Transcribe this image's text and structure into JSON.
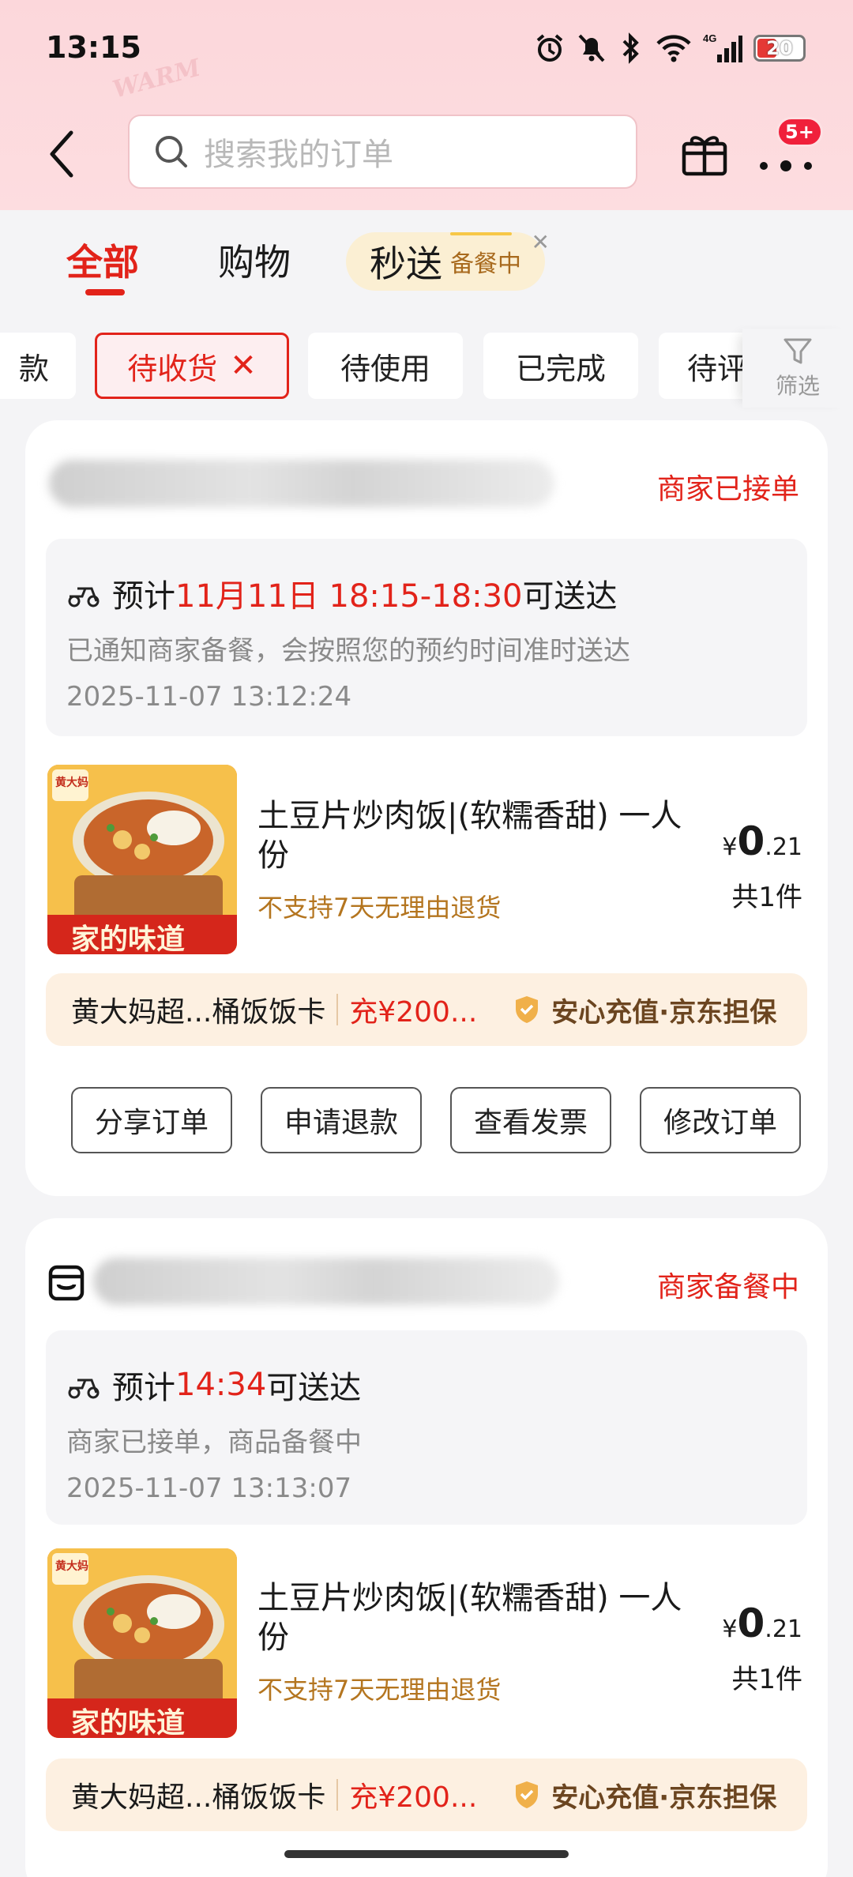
{
  "status_bar": {
    "time": "13:15",
    "battery": "20",
    "network": "4G"
  },
  "header": {
    "search_placeholder": "搜索我的订单",
    "badge": "5+",
    "deco_text": "WARM"
  },
  "tabs": {
    "all": "全部",
    "shopping": "购物",
    "instant": "秒送",
    "instant_status": "备餐中"
  },
  "filters": {
    "chips": [
      "款",
      "待收货",
      "待使用",
      "已完成",
      "待评"
    ],
    "filter_label": "筛选"
  },
  "orders": [
    {
      "status": "商家已接单",
      "eta_prefix": "预计",
      "eta_highlight": "11月11日 18:15-18:30",
      "eta_suffix": "可送达",
      "note": "已通知商家备餐，会按照您的预约时间准时送达",
      "timestamp": "2025-11-07 13:12:24",
      "product_name": "土豆片炒肉饭|(软糯香甜) 一人份",
      "product_tag": "不支持7天无理由退货",
      "price_symbol": "¥",
      "price_int": "0",
      "price_dec": ".21",
      "qty": "共1件",
      "image_banner": "家的味道",
      "image_brand": "黄大妈",
      "promo_name": "黄大妈超...桶饭饭卡",
      "promo_offer": "充¥200...",
      "promo_guarantee": "安心充值·京东担保",
      "buttons": [
        "分享订单",
        "申请退款",
        "查看发票",
        "修改订单"
      ]
    },
    {
      "status": "商家备餐中",
      "eta_prefix": "预计",
      "eta_highlight": "14:34",
      "eta_suffix": "可送达",
      "note": "商家已接单，商品备餐中",
      "timestamp": "2025-11-07 13:13:07",
      "product_name": "土豆片炒肉饭|(软糯香甜) 一人份",
      "product_tag": "不支持7天无理由退货",
      "price_symbol": "¥",
      "price_int": "0",
      "price_dec": ".21",
      "qty": "共1件",
      "image_banner": "家的味道",
      "image_brand": "黄大妈",
      "promo_name": "黄大妈超...桶饭饭卡",
      "promo_offer": "充¥200...",
      "promo_guarantee": "安心充值·京东担保"
    }
  ],
  "colors": {
    "accent_red": "#e2231a",
    "header_pink": "#fcd7db",
    "promo_bg": "#fdf0e1"
  }
}
